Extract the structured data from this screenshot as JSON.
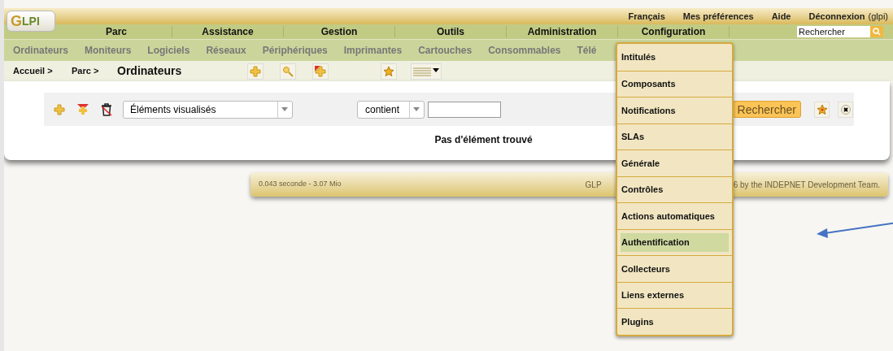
{
  "logo": {
    "text": "GLPI"
  },
  "top_links": [
    "Français",
    "Mes préférences",
    "Aide",
    "Déconnexion"
  ],
  "user": "(glpi)",
  "main_menu": [
    "Parc",
    "Assistance",
    "Gestion",
    "Outils",
    "Administration",
    "Configuration"
  ],
  "global_search": {
    "placeholder": "Rechercher"
  },
  "sub_menu": [
    "Ordinateurs",
    "Moniteurs",
    "Logiciels",
    "Réseaux",
    "Périphériques",
    "Imprimantes",
    "Cartouches",
    "Consommables",
    "Télé"
  ],
  "breadcrumb": [
    "Accueil >",
    "Parc >"
  ],
  "page_title": "Ordinateurs",
  "search_form": {
    "field": "Éléments visualisés",
    "operator": "contient",
    "submit": "Rechercher"
  },
  "result": "Pas d'élément trouvé",
  "footer": {
    "timing": "0.043 seconde - 3.07 Mio",
    "copyright_left": "GLP",
    "copyright_right": "6 by the INDEPNET Development Team."
  },
  "dropdown": [
    {
      "label": "Intitulés",
      "selected": false
    },
    {
      "label": "Composants",
      "selected": false
    },
    {
      "label": "Notifications",
      "selected": false
    },
    {
      "label": "SLAs",
      "selected": false
    },
    {
      "label": "Générale",
      "selected": false
    },
    {
      "label": "Contrôles",
      "selected": false
    },
    {
      "label": "Actions automatiques",
      "selected": false
    },
    {
      "label": "Authentification",
      "selected": true
    },
    {
      "label": "Collecteurs",
      "selected": false
    },
    {
      "label": "Liens externes",
      "selected": false
    },
    {
      "label": "Plugins",
      "selected": false
    }
  ]
}
